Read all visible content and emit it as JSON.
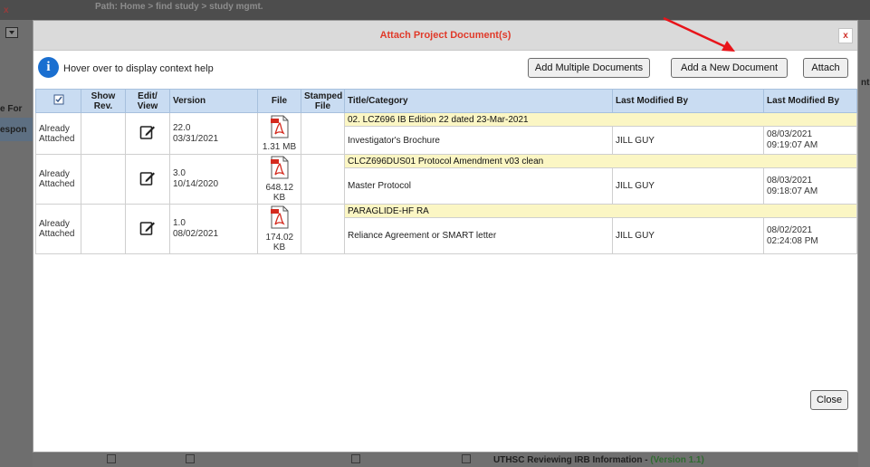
{
  "background": {
    "path_text": "Path: Home > find study > study mgmt.",
    "left_labels": [
      "e For",
      "espon"
    ],
    "right_labels": [
      "nt"
    ],
    "bottom_text": "UTHSC Reviewing IRB Information",
    "bottom_version": "(Version 1.1)"
  },
  "modal": {
    "title": "Attach Project Document(s)",
    "close_x": "x",
    "help_text": "Hover over to display context help",
    "buttons": {
      "add_multiple": "Add Multiple Documents",
      "add_new": "Add a New Document",
      "attach": "Attach",
      "close": "Close"
    },
    "table": {
      "headers": {
        "show_rev": "Show Rev.",
        "edit_view": "Edit/ View",
        "version": "Version",
        "file": "File",
        "stamped_file": "Stamped File",
        "title_category": "Title/Category",
        "last_modified_by": "Last Modified By",
        "last_modified_by_2": "Last Modified By"
      },
      "rows": [
        {
          "status": "Already Attached",
          "version": "22.0",
          "version_date": "03/31/2021",
          "file_size": "1.31 MB",
          "title": "02. LCZ696 IB Edition 22 dated 23-Mar-2021",
          "category": "Investigator's Brochure",
          "modified_by": "JILL GUY",
          "modified_date": "08/03/2021",
          "modified_time": "09:19:07 AM"
        },
        {
          "status": "Already Attached",
          "version": "3.0",
          "version_date": "10/14/2020",
          "file_size": "648.12 KB",
          "title": "CLCZ696DUS01 Protocol Amendment v03 clean",
          "category": "Master Protocol",
          "modified_by": "JILL GUY",
          "modified_date": "08/03/2021",
          "modified_time": "09:18:07 AM"
        },
        {
          "status": "Already Attached",
          "version": "1.0",
          "version_date": "08/02/2021",
          "file_size": "174.02 KB",
          "title": "PARAGLIDE-HF RA",
          "category": "Reliance Agreement or SMART letter",
          "modified_by": "JILL GUY",
          "modified_date": "08/02/2021",
          "modified_time": "02:24:08 PM"
        }
      ]
    }
  },
  "colors": {
    "title_red": "#e03a2a",
    "header_blue": "#c9dcf2",
    "title_band_yellow": "#fbf6c4",
    "info_blue": "#1a6fd0",
    "arrow_red": "#e8141a"
  }
}
